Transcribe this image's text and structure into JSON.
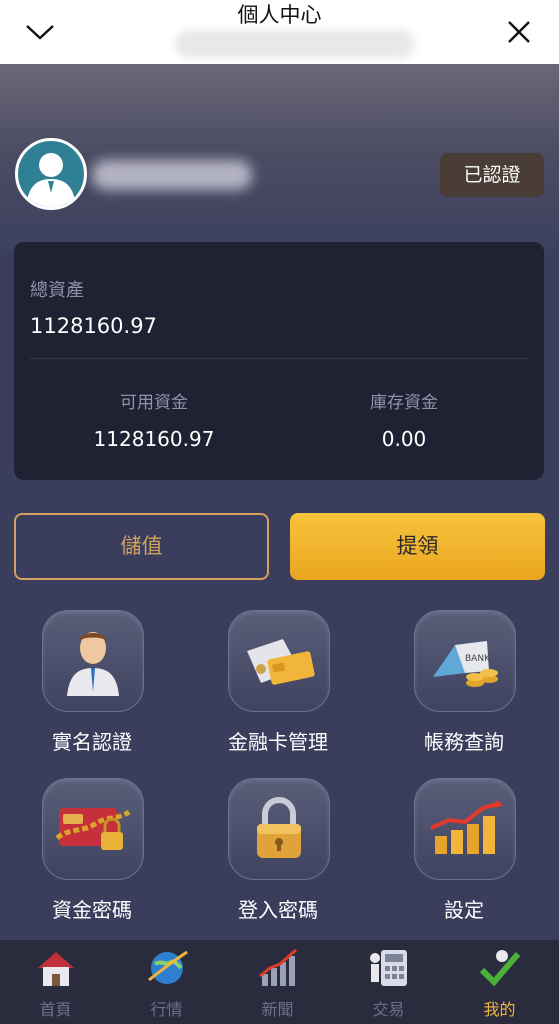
{
  "header": {
    "title": "個人中心"
  },
  "profile": {
    "verified_label": "已認證"
  },
  "assets": {
    "total_label": "總資產",
    "total_value": "1128160.97",
    "available_label": "可用資金",
    "available_value": "1128160.97",
    "stock_label": "庫存資金",
    "stock_value": "0.00"
  },
  "actions": {
    "deposit_label": "儲值",
    "withdraw_label": "提領"
  },
  "features": [
    {
      "label": "實名認證",
      "icon": "person-icon"
    },
    {
      "label": "金融卡管理",
      "icon": "bank-card-icon"
    },
    {
      "label": "帳務查詢",
      "icon": "bank-coins-icon"
    },
    {
      "label": "資金密碼",
      "icon": "chained-card-icon"
    },
    {
      "label": "登入密碼",
      "icon": "padlock-icon"
    },
    {
      "label": "設定",
      "icon": "growth-coins-icon"
    }
  ],
  "nav": {
    "items": [
      {
        "label": "首頁",
        "icon": "house-icon"
      },
      {
        "label": "行情",
        "icon": "globe-icon"
      },
      {
        "label": "新聞",
        "icon": "chart-icon"
      },
      {
        "label": "交易",
        "icon": "calculator-icon"
      },
      {
        "label": "我的",
        "icon": "checkmark-person-icon"
      }
    ],
    "active_index": 4
  },
  "colors": {
    "accent": "#f2b53b",
    "deposit_border": "#d4a060",
    "card_bg": "#1f2233",
    "page_bg": "#3a3e5c"
  }
}
